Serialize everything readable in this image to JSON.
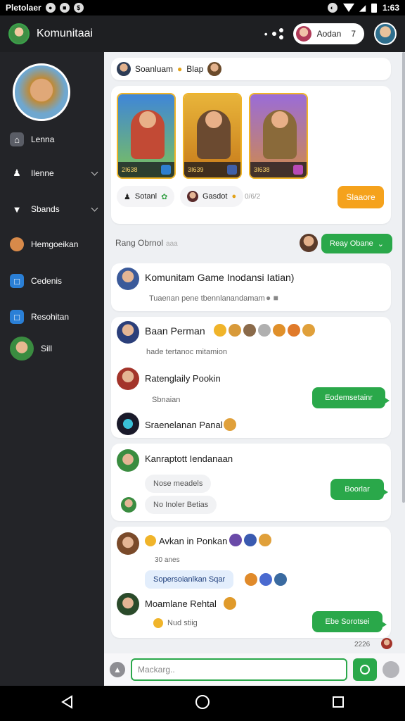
{
  "status_bar": {
    "carrier": "Pletolaer",
    "time": "1:63"
  },
  "header": {
    "title": "Komunitaai",
    "user_pill_label": "Aodan",
    "user_pill_count": "7"
  },
  "sidebar": {
    "items": [
      {
        "label": "Lenna",
        "icon": "home-icon"
      },
      {
        "label": "Ilenne",
        "icon": "users-icon",
        "has_chevron": true
      },
      {
        "label": "Sbands",
        "icon": "controller-icon",
        "has_chevron": true
      },
      {
        "label": "Hemgoeikan",
        "icon": "avatar-icon"
      },
      {
        "label": "Cedenis",
        "icon": "square-icon"
      },
      {
        "label": "Resohitan",
        "icon": "square-icon"
      },
      {
        "label": "Sill",
        "icon": "avatar-icon"
      }
    ]
  },
  "top_card": {
    "text": "Soanluam",
    "tag": "Blap"
  },
  "game_card": {
    "tiles": [
      {
        "value": "2I638",
        "color": "#2f7fd0"
      },
      {
        "value": "3I639",
        "color": "#e6a21e"
      },
      {
        "value": "3I638",
        "color": "#8a58c8"
      }
    ],
    "chip_1": "Sotanl",
    "chip_2": "Gasdot",
    "meta": "0/6/2",
    "action_button": "Slaaore"
  },
  "section": {
    "label": "Rang Obrnol",
    "label_hint": "aaa",
    "dropdown_label": "Reay Obane"
  },
  "messages": [
    {
      "title": "Komunitam Game Inodansi Iatian)",
      "sub": "Tuaenan pene tbennlanandamam"
    },
    {
      "title": "Baan Perman",
      "sub": "hade tertanoc mitamion"
    },
    {
      "title": "Ratenglaily Pookin",
      "sub": "Sbnaian",
      "bubble": "Eodemsetainr"
    },
    {
      "title": "Sraenelanan Panal"
    },
    {
      "title": "Kanraptott Iendanaan",
      "chip_1": "Nose meadels",
      "chip_2": "No Inoler Betias",
      "bubble": "Boorlar"
    },
    {
      "title": "Avkan in Ponkan",
      "sub": "30 anes",
      "blue_chip": "Sopersoianlkan Sqar"
    },
    {
      "title": "Moamlane Rehtal",
      "sub": "Nud stiig",
      "bubble": "Ebe Sorotsei"
    }
  ],
  "footer_count": "2226",
  "composer": {
    "placeholder": "Mackarg.."
  }
}
